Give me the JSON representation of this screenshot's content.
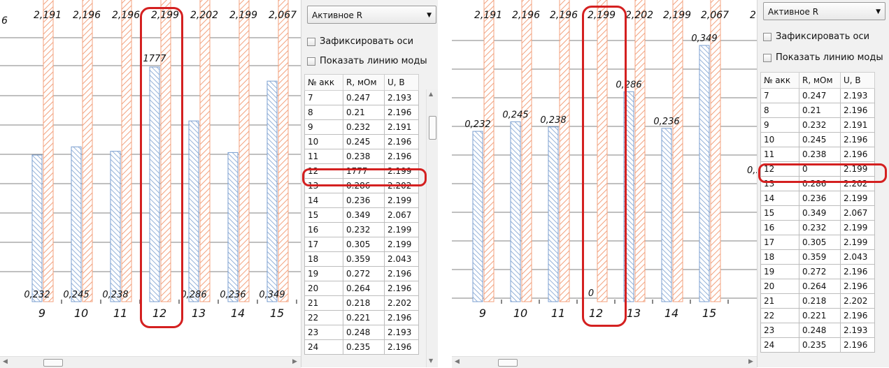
{
  "controls": {
    "mode_select": "Активное R",
    "fix_axes": "Зафиксировать оси",
    "show_mode_line": "Показать линию моды"
  },
  "table": {
    "headers": [
      "№ акк",
      "R, мОм",
      "U, В"
    ]
  },
  "left_panel": {
    "top_clip_label": "6",
    "rows": [
      [
        "7",
        "0.247",
        "2.193"
      ],
      [
        "8",
        "0.21",
        "2.196"
      ],
      [
        "9",
        "0.232",
        "2.191"
      ],
      [
        "10",
        "0.245",
        "2.196"
      ],
      [
        "11",
        "0.238",
        "2.196"
      ],
      [
        "12",
        "1777",
        "2.199"
      ],
      [
        "13",
        "0.286",
        "2.202"
      ],
      [
        "14",
        "0.236",
        "2.199"
      ],
      [
        "15",
        "0.349",
        "2.067"
      ],
      [
        "16",
        "0.232",
        "2.199"
      ],
      [
        "17",
        "0.305",
        "2.199"
      ],
      [
        "18",
        "0.359",
        "2.043"
      ],
      [
        "19",
        "0.272",
        "2.196"
      ],
      [
        "20",
        "0.264",
        "2.196"
      ],
      [
        "21",
        "0.218",
        "2.202"
      ],
      [
        "22",
        "0.221",
        "2.196"
      ],
      [
        "23",
        "0.248",
        "2.193"
      ],
      [
        "24",
        "0.235",
        "2.196"
      ]
    ]
  },
  "right_panel": {
    "top_clip_label": "2",
    "right_clip_label": "0,:",
    "rows": [
      [
        "7",
        "0.247",
        "2.193"
      ],
      [
        "8",
        "0.21",
        "2.196"
      ],
      [
        "9",
        "0.232",
        "2.191"
      ],
      [
        "10",
        "0.245",
        "2.196"
      ],
      [
        "11",
        "0.238",
        "2.196"
      ],
      [
        "12",
        "0",
        "2.199"
      ],
      [
        "13",
        "0.286",
        "2.202"
      ],
      [
        "14",
        "0.236",
        "2.199"
      ],
      [
        "15",
        "0.349",
        "2.067"
      ],
      [
        "16",
        "0.232",
        "2.199"
      ],
      [
        "17",
        "0.305",
        "2.199"
      ],
      [
        "18",
        "0.359",
        "2.043"
      ],
      [
        "19",
        "0.272",
        "2.196"
      ],
      [
        "20",
        "0.264",
        "2.196"
      ],
      [
        "21",
        "0.218",
        "2.202"
      ],
      [
        "22",
        "0.221",
        "2.196"
      ],
      [
        "23",
        "0.248",
        "2.193"
      ],
      [
        "24",
        "0.235",
        "2.196"
      ]
    ]
  },
  "colors": {
    "u_bar": "#f3a17d",
    "r_bar": "#7b9fd0",
    "highlight": "#d42020",
    "gridline": "#808080"
  },
  "chart_data": [
    {
      "type": "bar",
      "categories": [
        "9",
        "10",
        "11",
        "12",
        "13",
        "14",
        "15"
      ],
      "series": [
        {
          "values": [
            2.191,
            2.196,
            2.196,
            2.199,
            2.202,
            2.199,
            2.067
          ],
          "labels": [
            "2,191",
            "2,196",
            "2,196",
            "2,199",
            "2,202",
            "2,199",
            "2,067"
          ]
        },
        {
          "values": [
            0.232,
            0.245,
            0.238,
            1777,
            0.286,
            0.236,
            0.349
          ],
          "labels": [
            "0,232",
            "0,245",
            "0,238",
            "1777",
            "0,286",
            "0,236",
            "0,349"
          ]
        }
      ],
      "highlighted_category": "12",
      "grid": true
    },
    {
      "type": "bar",
      "categories": [
        "9",
        "10",
        "11",
        "12",
        "13",
        "14",
        "15"
      ],
      "series": [
        {
          "values": [
            2.191,
            2.196,
            2.196,
            2.199,
            2.202,
            2.199,
            2.067
          ],
          "labels": [
            "2,191",
            "2,196",
            "2,196",
            "2,199",
            "2,202",
            "2,199",
            "2,067"
          ]
        },
        {
          "values": [
            0.232,
            0.245,
            0.238,
            0,
            0.286,
            0.236,
            0.349
          ],
          "labels": [
            "0,232",
            "0,245",
            "0,238",
            "0",
            "0,286",
            "0,236",
            "0,349"
          ]
        }
      ],
      "highlighted_category": "12",
      "grid": true
    }
  ]
}
